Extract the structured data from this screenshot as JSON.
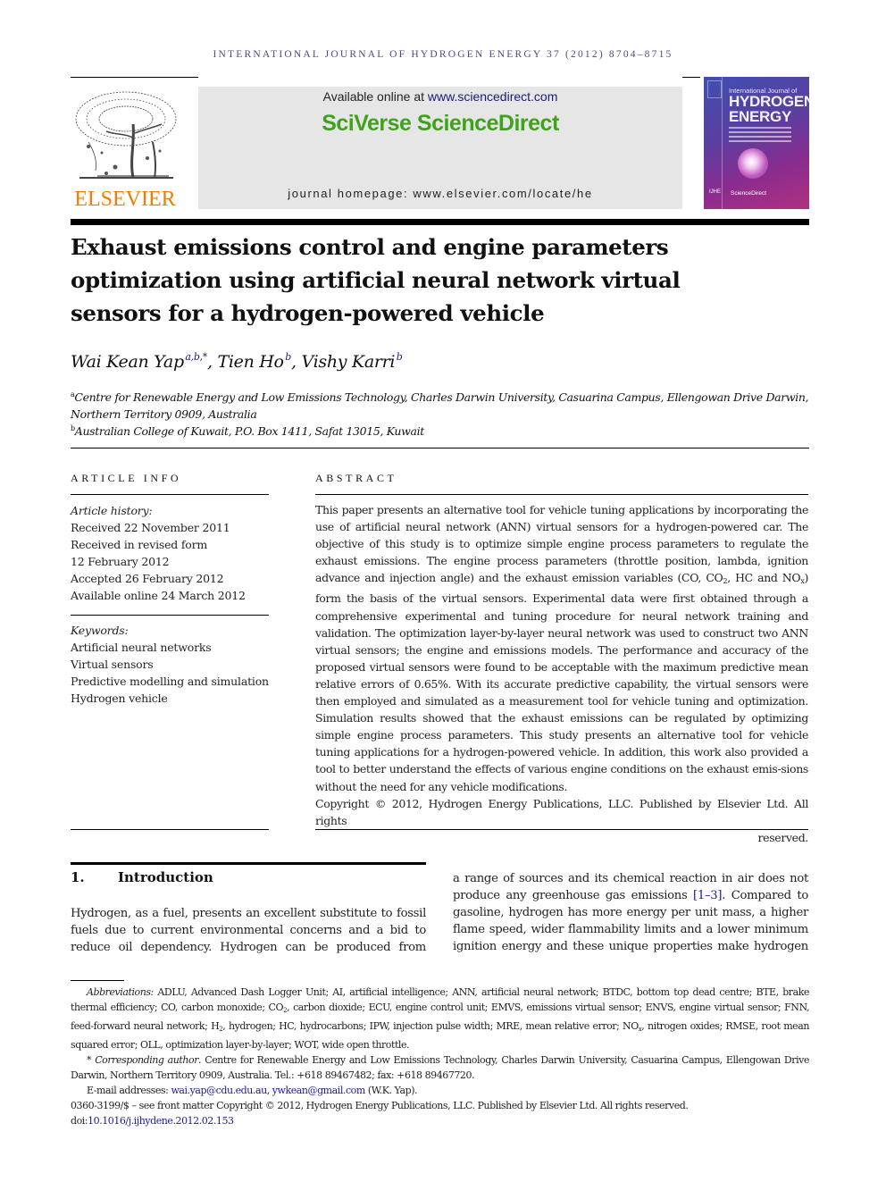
{
  "running_head": "INTERNATIONAL JOURNAL OF HYDROGEN ENERGY 37 (2012) 8704–8715",
  "header": {
    "publisher_name": "ELSEVIER",
    "available_prefix": "Available online at ",
    "available_link": "www.sciencedirect.com",
    "platform": "SciVerse ScienceDirect",
    "homepage": "journal homepage: www.elsevier.com/locate/he",
    "cover": {
      "line1": "International Journal of",
      "line2": "HYDROGEN",
      "line3": "ENERGY",
      "footer": "ScienceDirect",
      "badge": "IJHE"
    },
    "colors": {
      "elsevier_orange": "#f07d00",
      "sciverse_green": "#3ea31b",
      "link_blue": "#1a1a7a"
    }
  },
  "article": {
    "title_lines": [
      "Exhaust emissions control and engine parameters",
      "optimization using artificial neural network virtual",
      "sensors for a hydrogen-powered vehicle"
    ],
    "authors": [
      {
        "name": "Wai Kean Yap",
        "sup": "a,b,*",
        "sep": ", "
      },
      {
        "name": "Tien Ho",
        "sup": "b",
        "sep": ", "
      },
      {
        "name": "Vishy Karri",
        "sup": "b",
        "sep": ""
      }
    ],
    "affiliations": [
      {
        "mark": "a",
        "text": "Centre for Renewable Energy and Low Emissions Technology, Charles Darwin University, Casuarina Campus, Ellengowan Drive Darwin, Northern Territory 0909, Australia"
      },
      {
        "mark": "b",
        "text": "Australian College of Kuwait, P.O. Box 1411, Safat 13015, Kuwait"
      }
    ]
  },
  "article_info": {
    "heading": "ARTICLE INFO",
    "history_label": "Article history:",
    "history": [
      "Received 22 November 2011",
      "Received in revised form",
      "12 February 2012",
      "Accepted 26 February 2012",
      "Available online 24 March 2012"
    ],
    "keywords_label": "Keywords:",
    "keywords": [
      "Artificial neural networks",
      "Virtual sensors",
      "Predictive modelling and simulation",
      "Hydrogen vehicle"
    ]
  },
  "abstract": {
    "heading": "ABSTRACT",
    "part1": "This paper presents an alternative tool for vehicle tuning applications by incorporating the use of artificial neural network (ANN) virtual sensors for a hydrogen-powered car. The objective of this study is to optimize simple engine process parameters to regulate the exhaust emissions. The engine process parameters (throttle position, lambda, ignition advance and injection angle) and the exhaust emission variables (CO, CO",
    "sub1": "2",
    "part2": ", HC and NO",
    "sub2": "x",
    "part3": ") form the basis of the virtual sensors. Experimental data were first obtained through a comprehensive experimental and tuning procedure for neural network training and validation. The optimization layer-by-layer neural network was used to construct two ANN virtual sensors; the engine and emissions models. The performance and accuracy of the proposed virtual sensors were found to be acceptable with the maximum predictive mean relative errors of 0.65%. With its accurate predictive capability, the virtual sensors were then employed and simulated as a measurement tool for vehicle tuning and optimization. Simulation results showed that the exhaust emissions can be regulated by optimizing simple engine process parameters. This study presents an alternative tool for vehicle tuning applications for a hydrogen-powered vehicle. In addition, this work also provided a tool to better understand the effects of various engine conditions on the exhaust emis-sions without the need for any vehicle modifications.",
    "copyright": "Copyright © 2012, Hydrogen Energy Publications, LLC. Published by Elsevier Ltd. All rights",
    "copyright_end": "reserved."
  },
  "introduction": {
    "number": "1.",
    "heading": "Introduction",
    "left_text": "Hydrogen, as a fuel, presents an excellent substitute to fossil fuels due to current environmental concerns and a bid to reduce oil dependency. Hydrogen can be produced from",
    "right_text_a": "a range of sources and its chemical reaction in air does not produce any greenhouse gas emissions ",
    "right_ref": "[1–3]",
    "right_text_b": ". Compared to gasoline, hydrogen has more energy per unit mass, a higher flame speed, wider flammability limits and a lower minimum ignition energy and these unique properties make hydrogen"
  },
  "footnotes": {
    "abbrev_label": "Abbreviations:",
    "abbrev_a": " ADLU, Advanced Dash Logger Unit; AI, artificial intelligence; ANN, artificial neural network; BTDC, bottom top dead centre; BTE, brake thermal efficiency; CO, carbon monoxide; CO",
    "abbrev_sub1": "2",
    "abbrev_b": ", carbon dioxide; ECU, engine control unit; EMVS, emissions virtual sensor; ENVS, engine virtual sensor; FNN, feed-forward neural network; H",
    "abbrev_sub2": "2",
    "abbrev_c": ", hydrogen; HC, hydrocarbons; IPW, injection pulse width; MRE, mean relative error; NO",
    "abbrev_sub3": "x",
    "abbrev_d": ", nitrogen oxides; RMSE, root mean squared error; OLL, optimization layer-by-layer; WOT, wide open throttle.",
    "corr_mark": "* ",
    "corr_label": "Corresponding author",
    "corr_text": ". Centre for Renewable Energy and Low Emissions Technology, Charles Darwin University, Casuarina Campus, Ellengowan Drive Darwin, Northern Territory 0909, Australia. Tel.: +618 89467482; fax: +618 89467720.",
    "email_label": "E-mail addresses: ",
    "email1": "wai.yap@cdu.edu.au",
    "email_sep": ", ",
    "email2": "ywkean@gmail.com",
    "email_suffix": " (W.K. Yap).",
    "issn_line": "0360-3199/$ – see front matter Copyright © 2012, Hydrogen Energy Publications, LLC. Published by Elsevier Ltd. All rights reserved.",
    "doi_prefix": "doi:",
    "doi": "10.1016/j.ijhydene.2012.02.153"
  }
}
